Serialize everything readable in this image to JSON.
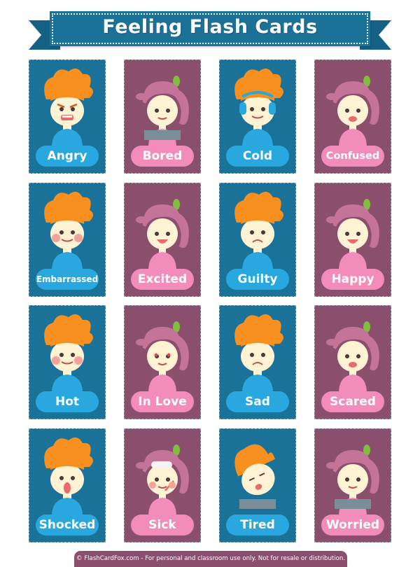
{
  "header": {
    "title": "Feeling Flash Cards"
  },
  "colors": {
    "boy_card": "#1b7299",
    "girl_card": "#8b4f6e",
    "boy_label": "#29a8e0",
    "girl_label": "#f28dbb",
    "boy_hair": "#f7901e",
    "girl_hair": "#c47399",
    "skin": "#fff3d4"
  },
  "cards": [
    {
      "label": "Angry",
      "character": "boy",
      "illustration": "angry-boy-illustration"
    },
    {
      "label": "Bored",
      "character": "girl",
      "illustration": "bored-girl-illustration"
    },
    {
      "label": "Cold",
      "character": "boy",
      "illustration": "cold-boy-illustration"
    },
    {
      "label": "Confused",
      "character": "girl",
      "illustration": "confused-girl-illustration"
    },
    {
      "label": "Embarrassed",
      "character": "boy",
      "illustration": "embarrassed-boy-illustration"
    },
    {
      "label": "Excited",
      "character": "girl",
      "illustration": "excited-girl-illustration"
    },
    {
      "label": "Guilty",
      "character": "boy",
      "illustration": "guilty-boy-illustration"
    },
    {
      "label": "Happy",
      "character": "girl",
      "illustration": "happy-girl-illustration"
    },
    {
      "label": "Hot",
      "character": "boy",
      "illustration": "hot-boy-illustration"
    },
    {
      "label": "In Love",
      "character": "girl",
      "illustration": "in-love-girl-illustration"
    },
    {
      "label": "Sad",
      "character": "boy",
      "illustration": "sad-boy-illustration"
    },
    {
      "label": "Scared",
      "character": "girl",
      "illustration": "scared-girl-illustration"
    },
    {
      "label": "Shocked",
      "character": "boy",
      "illustration": "shocked-boy-illustration"
    },
    {
      "label": "Sick",
      "character": "girl",
      "illustration": "sick-girl-illustration"
    },
    {
      "label": "Tired",
      "character": "boy",
      "illustration": "tired-boy-illustration"
    },
    {
      "label": "Worried",
      "character": "girl",
      "illustration": "worried-girl-illustration"
    }
  ],
  "footer": {
    "text": "© FlashCardFox.com - For personal and classroom use only. Not for resale or distribution."
  }
}
